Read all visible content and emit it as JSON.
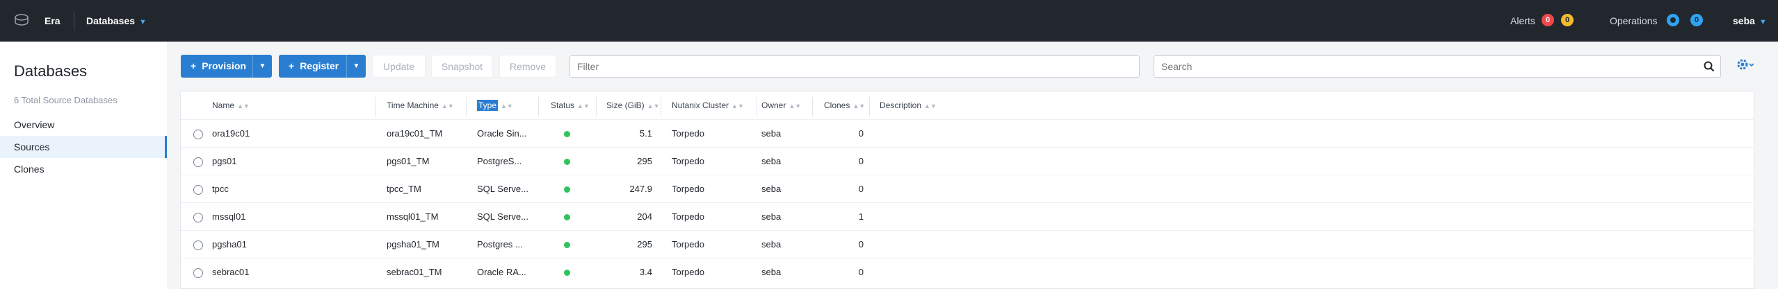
{
  "topbar": {
    "app_name": "Era",
    "nav_label": "Databases",
    "alerts_label": "Alerts",
    "alerts_red": "0",
    "alerts_yellow": "0",
    "operations_label": "Operations",
    "operations_running": "",
    "operations_count": "0",
    "user": "seba"
  },
  "sidebar": {
    "title": "Databases",
    "subtitle": "6 Total Source Databases",
    "items": [
      {
        "label": "Overview"
      },
      {
        "label": "Sources",
        "active": true
      },
      {
        "label": "Clones"
      }
    ]
  },
  "toolbar": {
    "provision_label": "Provision",
    "register_label": "Register",
    "update_label": "Update",
    "snapshot_label": "Snapshot",
    "remove_label": "Remove",
    "filter_placeholder": "Filter",
    "search_placeholder": "Search"
  },
  "table": {
    "columns": [
      "Name",
      "Time Machine",
      "Type",
      "Status",
      "Size (GiB)",
      "Nutanix Cluster",
      "Owner",
      "Clones",
      "Description"
    ],
    "status_color": "#2ec45c",
    "rows": [
      {
        "name": "ora19c01",
        "time_machine": "ora19c01_TM",
        "type": "Oracle Sin...",
        "size": "5.1",
        "cluster": "Torpedo",
        "owner": "seba",
        "clones": "0",
        "description": ""
      },
      {
        "name": "pgs01",
        "time_machine": "pgs01_TM",
        "type": "PostgreS...",
        "size": "295",
        "cluster": "Torpedo",
        "owner": "seba",
        "clones": "0",
        "description": ""
      },
      {
        "name": "tpcc",
        "time_machine": "tpcc_TM",
        "type": "SQL Serve...",
        "size": "247.9",
        "cluster": "Torpedo",
        "owner": "seba",
        "clones": "0",
        "description": ""
      },
      {
        "name": "mssql01",
        "time_machine": "mssql01_TM",
        "type": "SQL Serve...",
        "size": "204",
        "cluster": "Torpedo",
        "owner": "seba",
        "clones": "1",
        "description": ""
      },
      {
        "name": "pgsha01",
        "time_machine": "pgsha01_TM",
        "type": "Postgres ...",
        "size": "295",
        "cluster": "Torpedo",
        "owner": "seba",
        "clones": "0",
        "description": ""
      },
      {
        "name": "sebrac01",
        "time_machine": "sebrac01_TM",
        "type": "Oracle RA...",
        "size": "3.4",
        "cluster": "Torpedo",
        "owner": "seba",
        "clones": "0",
        "description": ""
      }
    ]
  }
}
